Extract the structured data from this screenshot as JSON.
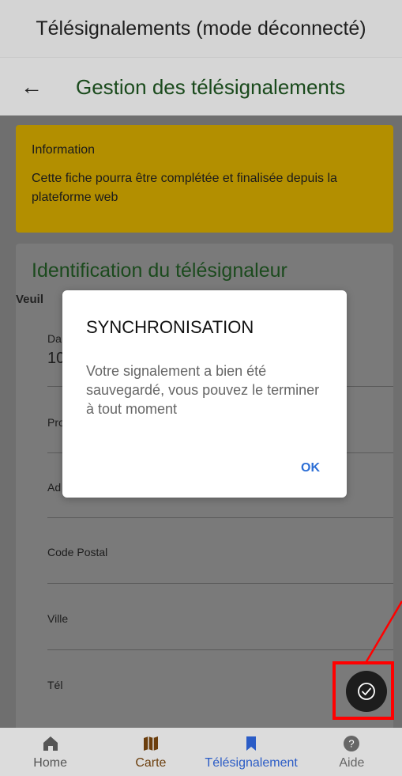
{
  "app_title": "Télésignalements (mode déconnecté)",
  "header": {
    "title": "Gestion des télésignalements"
  },
  "info_box": {
    "title": "Information",
    "text": "Cette fiche pourra être complétée et finalisée depuis la plateforme web"
  },
  "card": {
    "title": "Identification du télésignaleur",
    "subtitle_visible": "Veuil"
  },
  "fields": {
    "date_label": "Da",
    "date_value": "10",
    "prenom_label": "Pro",
    "adresse_label": "Ad",
    "code_postal_label": "Code Postal",
    "ville_label": "Ville",
    "tel_label": "Tél"
  },
  "dialog": {
    "title": "SYNCHRONISATION",
    "message": "Votre signalement a bien été sauvegardé, vous pouvez le terminer à tout moment",
    "ok": "OK"
  },
  "bottom_nav": {
    "items": [
      {
        "label": "Home",
        "icon": "home-icon",
        "color": "#555555"
      },
      {
        "label": "Carte",
        "icon": "map-icon",
        "color": "#6b3e0d"
      },
      {
        "label": "Télésignalement",
        "icon": "bookmark-icon",
        "color": "#2b5cc6"
      },
      {
        "label": "Aide",
        "icon": "help-icon",
        "color": "#666666"
      }
    ]
  },
  "colors": {
    "info_yellow": "#b38f00",
    "header_green": "#1a4a1c",
    "ok_blue": "#2d6fd6",
    "highlight_red": "#ff0000"
  }
}
